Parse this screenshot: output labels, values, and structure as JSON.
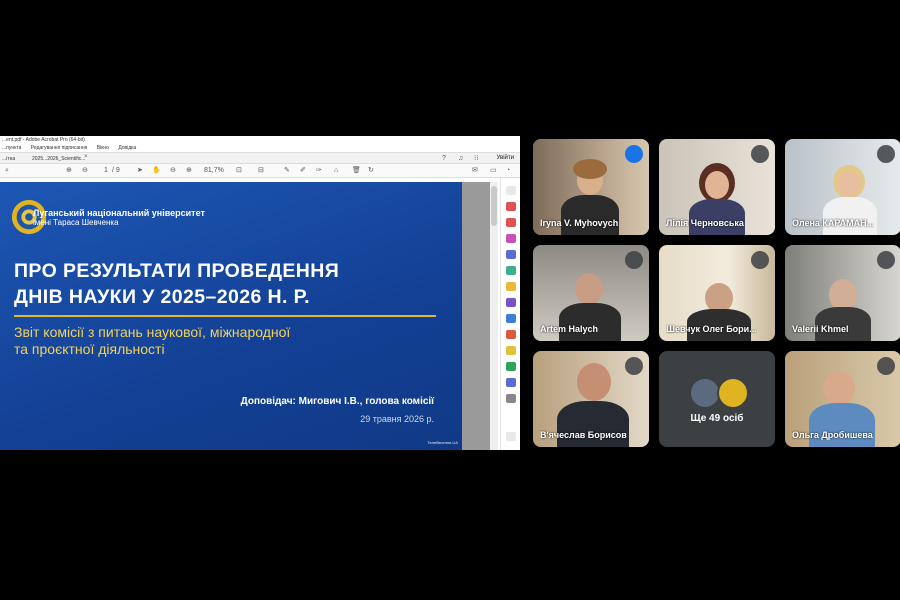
{
  "pdf_window": {
    "title": "...ent.pdf - Adobe Acrobat Pro (64-bit)",
    "menu": [
      "...пункта",
      "Вікно",
      "Довідка"
    ],
    "menu_faint": "Редагування підписання",
    "tabs": [
      "...ітна",
      "2025...2026_Scientific..."
    ],
    "share_label": "Увійти",
    "page_current": "1",
    "page_total": "/ 9",
    "zoom": "81,7%"
  },
  "slide": {
    "university_line1": "Луганський національний університет",
    "university_line2": "імені Тараса Шевченка",
    "title_line1": "ПРО РЕЗУЛЬТАТИ ПРОВЕДЕННЯ",
    "title_line2": "ДНІВ НАУКИ У 2025–2026 Н. Р.",
    "subtitle_line1": "Звіт комісії з питань наукової, міжнародної",
    "subtitle_line2": "та проєктної діяльності",
    "speaker": "Доповідач: Мигович І.В., голова комісії",
    "date": "29 травня 2026 р.",
    "watermark": "Телебачення.UA",
    "accent_color": "#e3b923",
    "background_color": "#174a9e"
  },
  "participants": [
    {
      "name": "Iryna V. Myhovych",
      "state": "speaking"
    },
    {
      "name": "Лілія Черновська",
      "state": "muted"
    },
    {
      "name": "Олена КАРАМАН...",
      "state": "muted"
    },
    {
      "name": "Artem Halych",
      "state": "muted"
    },
    {
      "name": "Шевчук Олег Бори...",
      "state": "muted"
    },
    {
      "name": "Valerii Khmel",
      "state": "muted"
    },
    {
      "name": "В'ячеслав Борисов",
      "state": "muted"
    },
    {
      "name": "Ще 49 осіб",
      "state": "overflow"
    },
    {
      "name": "Ольга Дробишева",
      "state": "muted"
    }
  ]
}
